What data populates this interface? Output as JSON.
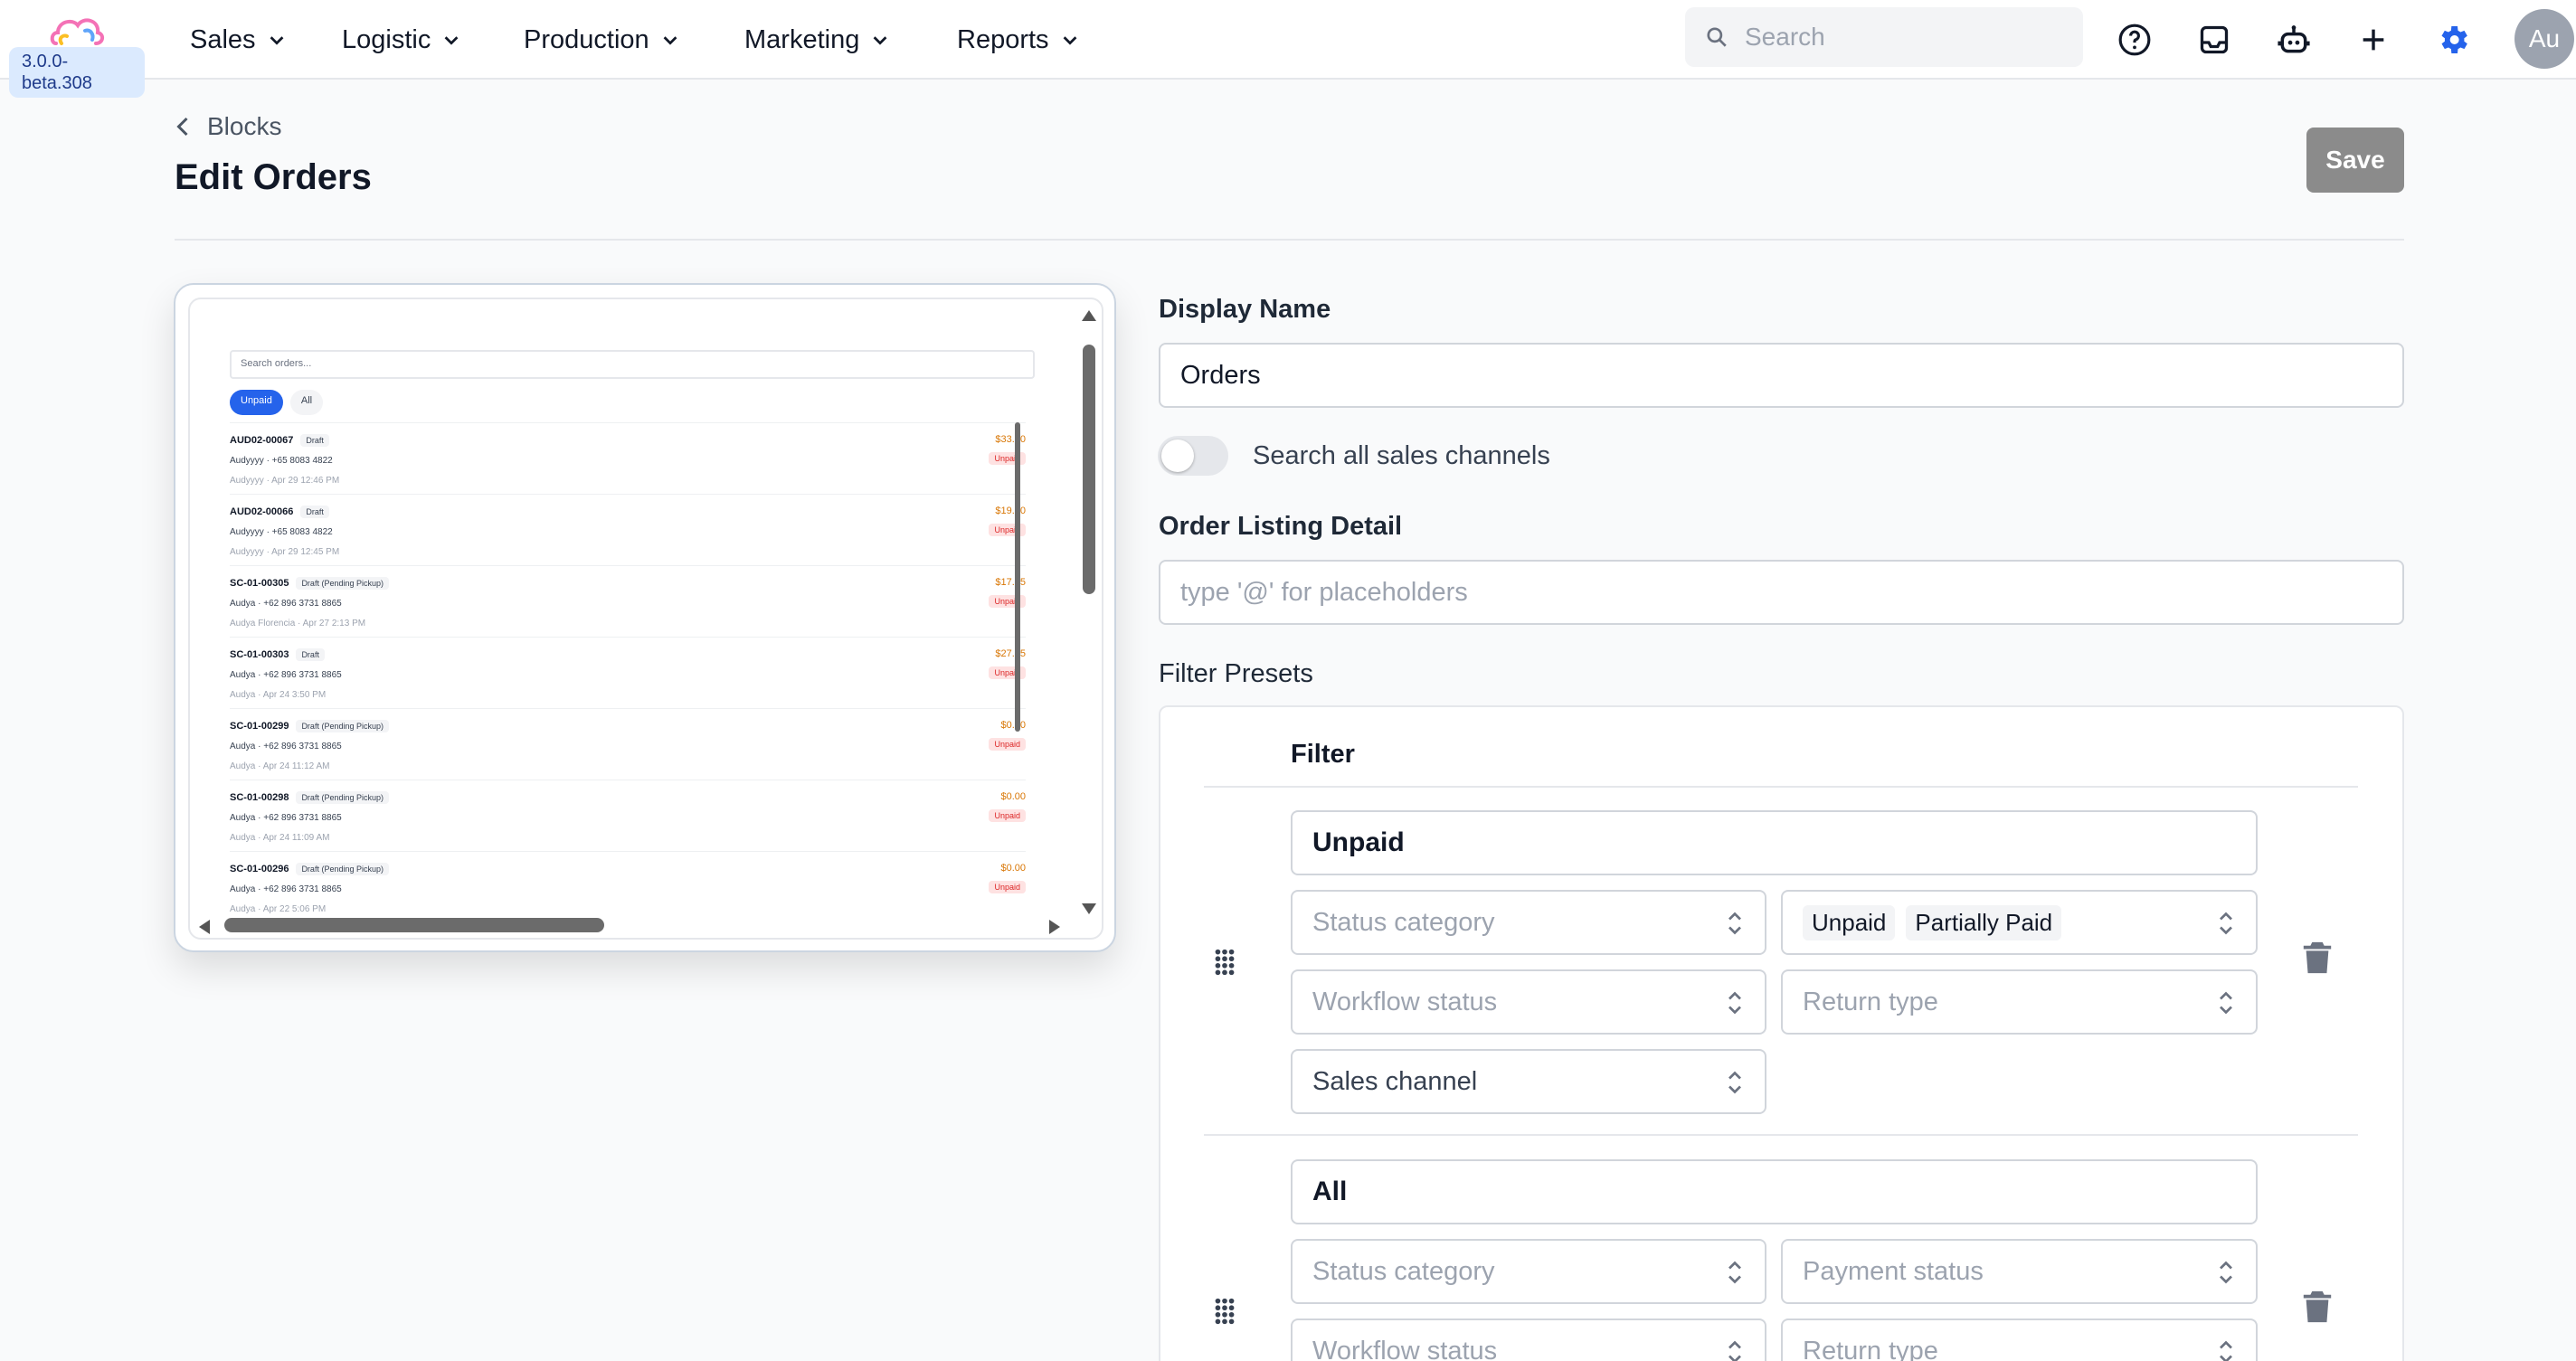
{
  "app": {
    "version": "3.0.0-beta.308"
  },
  "nav": {
    "items": [
      {
        "label": "Sales"
      },
      {
        "label": "Logistic"
      },
      {
        "label": "Production"
      },
      {
        "label": "Marketing"
      },
      {
        "label": "Reports"
      }
    ],
    "search_placeholder": "Search",
    "icons": [
      "help-circle-icon",
      "inbox-icon",
      "robot-icon",
      "plus-icon",
      "gear-icon"
    ],
    "accent_color": "#2563eb",
    "avatar_initials": "Au"
  },
  "header": {
    "breadcrumb": "Blocks",
    "title": "Edit Orders",
    "save_label": "Save"
  },
  "preview": {
    "search_placeholder": "Search orders...",
    "chips": [
      "Unpaid",
      "All"
    ],
    "orders": [
      {
        "id": "AUD02-00067",
        "tag": "Draft",
        "customer": "Audyyyy · +65 8083 4822",
        "time": "Audyyyy · Apr 29 12:46 PM",
        "amount": "$33.70",
        "payment": "Unpaid"
      },
      {
        "id": "AUD02-00066",
        "tag": "Draft",
        "customer": "Audyyyy · +65 8083 4822",
        "time": "Audyyyy · Apr 29 12:45 PM",
        "amount": "$19.60",
        "payment": "Unpaid"
      },
      {
        "id": "SC-01-00305",
        "tag": "Draft (Pending Pickup)",
        "customer": "Audya · +62 896 3731 8865",
        "time": "Audya Florencia · Apr 27 2:13 PM",
        "amount": "$17.75",
        "payment": "Unpaid"
      },
      {
        "id": "SC-01-00303",
        "tag": "Draft",
        "customer": "Audya · +62 896 3731 8865",
        "time": "Audya · Apr 24 3:50 PM",
        "amount": "$27.45",
        "payment": "Unpaid"
      },
      {
        "id": "SC-01-00299",
        "tag": "Draft (Pending Pickup)",
        "customer": "Audya · +62 896 3731 8865",
        "time": "Audya · Apr 24 11:12 AM",
        "amount": "$0.00",
        "payment": "Unpaid"
      },
      {
        "id": "SC-01-00298",
        "tag": "Draft (Pending Pickup)",
        "customer": "Audya · +62 896 3731 8865",
        "time": "Audya · Apr 24 11:09 AM",
        "amount": "$0.00",
        "payment": "Unpaid"
      },
      {
        "id": "SC-01-00296",
        "tag": "Draft (Pending Pickup)",
        "customer": "Audya · +62 896 3731 8865",
        "time": "Audya · Apr 22 5:06 PM",
        "amount": "$0.00",
        "payment": "Unpaid"
      }
    ]
  },
  "form": {
    "display_name_label": "Display Name",
    "display_name_value": "Orders",
    "search_all_label": "Search all sales channels",
    "search_all_enabled": false,
    "order_listing_label": "Order Listing Detail",
    "order_listing_placeholder": "type '@' for placeholders",
    "filter_presets_label": "Filter Presets",
    "filter_column_label": "Filter",
    "presets": [
      {
        "name": "Unpaid",
        "status_category": "Status category",
        "payment_status_values": [
          "Unpaid",
          "Partially Paid"
        ],
        "workflow_status": "Workflow status",
        "return_type": "Return type",
        "sales_channel": "Sales channel"
      },
      {
        "name": "All",
        "status_category": "Status category",
        "payment_status": "Payment status",
        "workflow_status": "Workflow status",
        "return_type": "Return type"
      }
    ]
  }
}
